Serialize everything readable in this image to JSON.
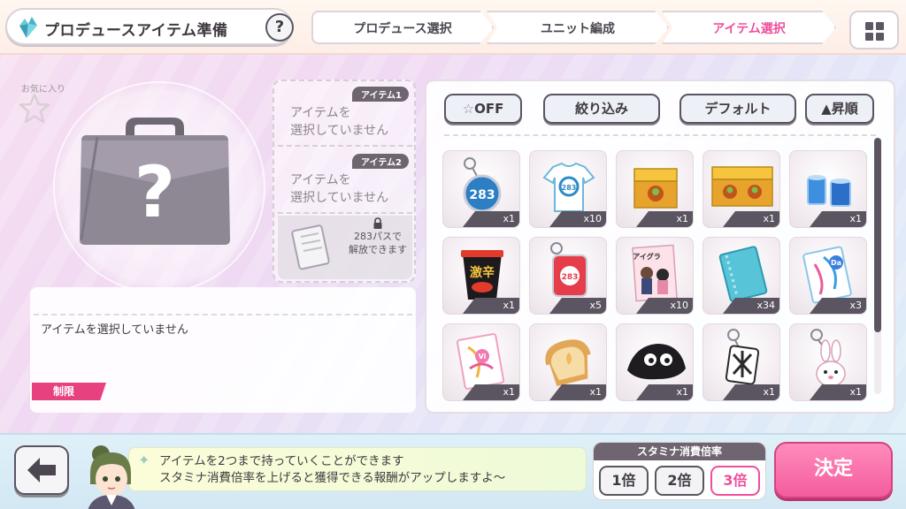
{
  "header": {
    "title": "プロデュースアイテム準備",
    "help_label": "?",
    "steps": [
      "プロデュース選択",
      "ユニット編成",
      "アイテム選択"
    ],
    "active_step": 2,
    "menu_icon": "grid-menu-icon"
  },
  "preview": {
    "favorite_label": "お気に入り",
    "favorite_icon": "star-outline-icon",
    "item_icon": "briefcase-question-icon",
    "description": "アイテムを選択していません",
    "limit_label": "制限"
  },
  "slots": [
    {
      "tag": "アイテム1",
      "text_1": "アイテムを",
      "text_2": "選択していません"
    },
    {
      "tag": "アイテム2",
      "text_1": "アイテムを",
      "text_2": "選択していません"
    }
  ],
  "locked_slot": {
    "note_1": "283パスで",
    "note_2": "解放できます"
  },
  "filters": {
    "favorite_toggle": "OFF",
    "narrow": "絞り込み",
    "sort_mode": "デフォルト",
    "order": "▲昇順"
  },
  "items": [
    {
      "icon": "keychain-blue-icon",
      "count": "x1"
    },
    {
      "icon": "tshirt-icon",
      "count": "x10"
    },
    {
      "icon": "bento-box-icon",
      "count": "x1"
    },
    {
      "icon": "double-bento-box-icon",
      "count": "x1"
    },
    {
      "icon": "blue-candles-icon",
      "count": "x1"
    },
    {
      "icon": "cup-noodle-icon",
      "count": "x1"
    },
    {
      "icon": "keychain-red-icon",
      "count": "x5"
    },
    {
      "icon": "magazine-icon",
      "count": "x10"
    },
    {
      "icon": "notebook-blue-icon",
      "count": "x34"
    },
    {
      "icon": "dance-card-icon",
      "count": "x3"
    },
    {
      "icon": "visual-card-icon",
      "count": "x1"
    },
    {
      "icon": "toast-icon",
      "count": "x1"
    },
    {
      "icon": "black-mascot-icon",
      "count": "x1"
    },
    {
      "icon": "keychain-black-icon",
      "count": "x1"
    },
    {
      "icon": "bunny-keychain-icon",
      "count": "x1"
    }
  ],
  "footer": {
    "back_icon": "arrow-left-icon",
    "message_1": "アイテムを2つまで持っていくことができます",
    "message_2": "スタミナ消費倍率を上げると獲得できる報酬がアップしますよ～",
    "stamina_title": "スタミナ消費倍率",
    "rates": [
      "1倍",
      "2倍",
      "3倍"
    ],
    "active_rate": 2,
    "confirm_label": "決定"
  },
  "colors": {
    "accent_pink": "#ef4f9c",
    "tag_gray": "#6e6570",
    "limit_red": "#e8417f"
  }
}
